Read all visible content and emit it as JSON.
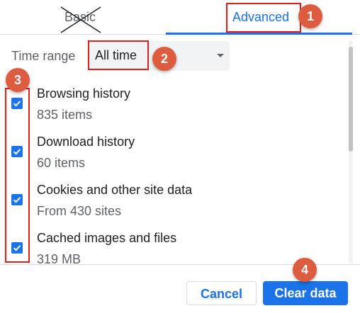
{
  "tabs": {
    "basic_label": "Basic",
    "advanced_label": "Advanced"
  },
  "time_range": {
    "label": "Time range",
    "selected": "All time"
  },
  "items": [
    {
      "title": "Browsing history",
      "detail": "835 items",
      "checked": true
    },
    {
      "title": "Download history",
      "detail": "60 items",
      "checked": true
    },
    {
      "title": "Cookies and other site data",
      "detail": "From 430 sites",
      "checked": true
    },
    {
      "title": "Cached images and files",
      "detail": "319 MB",
      "checked": true
    }
  ],
  "buttons": {
    "cancel": "Cancel",
    "clear": "Clear data"
  },
  "annotations": {
    "marker_1": "1",
    "marker_2": "2",
    "marker_3": "3",
    "marker_4": "4"
  },
  "colors": {
    "accent": "#1a73e8",
    "annotation_box": "#e02020",
    "annotation_marker": "#dd5b3e"
  }
}
